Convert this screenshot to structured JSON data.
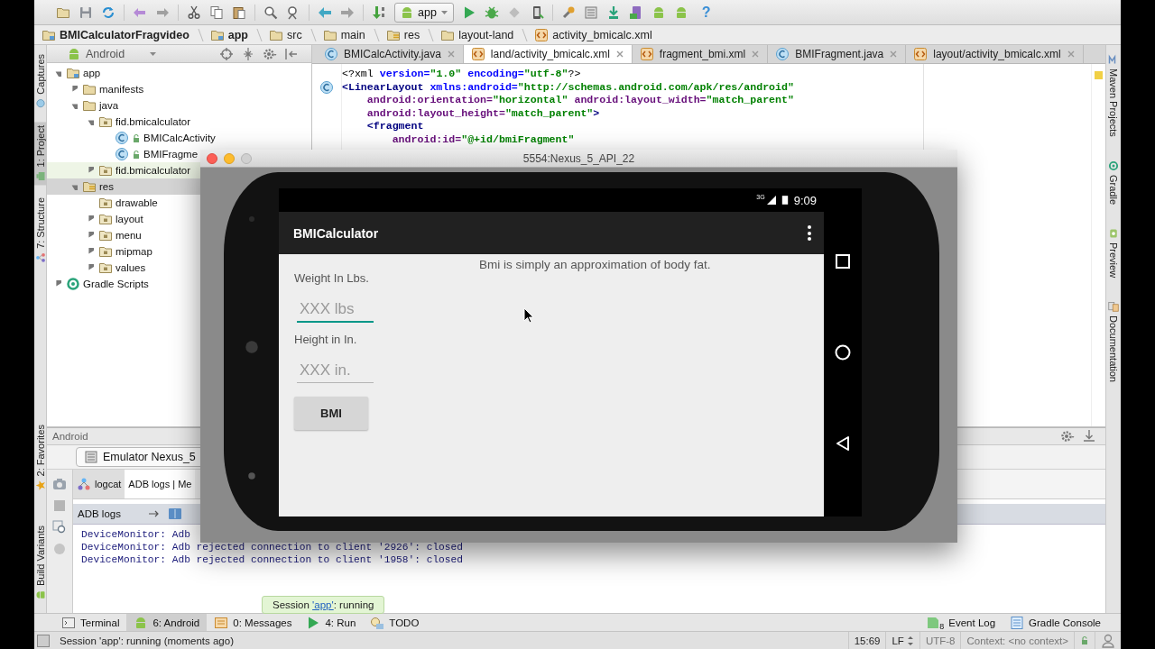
{
  "toolbar": {
    "run_config": "app",
    "help": "?"
  },
  "breadcrumbs": [
    {
      "label": "BMICalculatorFragvideo",
      "kind": "module"
    },
    {
      "label": "app",
      "kind": "module"
    },
    {
      "label": "src",
      "kind": "folder"
    },
    {
      "label": "main",
      "kind": "folder"
    },
    {
      "label": "res",
      "kind": "res"
    },
    {
      "label": "layout-land",
      "kind": "folder"
    },
    {
      "label": "activity_bmicalc.xml",
      "kind": "xml"
    }
  ],
  "left_stripe": {
    "top": [
      {
        "label": "Captures",
        "kind": "captures",
        "selected": false
      },
      {
        "label": "1: Project",
        "kind": "project",
        "selected": true
      },
      {
        "label": "7: Structure",
        "kind": "structure",
        "selected": false
      }
    ],
    "bottom": [
      {
        "label": "2: Favorites",
        "kind": "favorites",
        "selected": false
      },
      {
        "label": "Build Variants",
        "kind": "variants",
        "selected": false
      }
    ]
  },
  "project_panel": {
    "view": "Android",
    "tree": [
      {
        "label": "app",
        "kind": "module",
        "expanded": true,
        "selected": false,
        "children": [
          {
            "label": "manifests",
            "kind": "folder",
            "expanded": false,
            "selected": false
          },
          {
            "label": "java",
            "kind": "folder",
            "expanded": true,
            "selected": false,
            "children": [
              {
                "label": "fid.bmicalculator",
                "kind": "package",
                "expanded": true,
                "selected": false,
                "children": [
                  {
                    "label": "BMICalcActivity",
                    "kind": "class",
                    "selected": false
                  },
                  {
                    "label": "BMIFragme",
                    "kind": "class",
                    "selected": false
                  }
                ]
              },
              {
                "label": "fid.bmicalculator",
                "kind": "package",
                "expanded": false,
                "selected": false,
                "highlighted": true
              }
            ]
          },
          {
            "label": "res",
            "kind": "res",
            "expanded": true,
            "selected": true,
            "children": [
              {
                "label": "drawable",
                "kind": "package",
                "selected": false
              },
              {
                "label": "layout",
                "kind": "package",
                "expanded": false,
                "selected": false
              },
              {
                "label": "menu",
                "kind": "package",
                "expanded": false,
                "selected": false
              },
              {
                "label": "mipmap",
                "kind": "package",
                "expanded": false,
                "selected": false
              },
              {
                "label": "values",
                "kind": "package",
                "expanded": false,
                "selected": false
              }
            ]
          }
        ]
      },
      {
        "label": "Gradle Scripts",
        "kind": "gradle",
        "expanded": false,
        "selected": false
      }
    ]
  },
  "editor": {
    "tabs": [
      {
        "label": "BMICalcActivity.java",
        "kind": "java",
        "selected": false
      },
      {
        "label": "land/activity_bmicalc.xml",
        "kind": "xml",
        "selected": true
      },
      {
        "label": "fragment_bmi.xml",
        "kind": "xml",
        "selected": false
      },
      {
        "label": "BMIFragment.java",
        "kind": "java",
        "selected": false
      },
      {
        "label": "layout/activity_bmicalc.xml",
        "kind": "xml",
        "selected": false
      }
    ],
    "lines": [
      [
        {
          "text": "<?xml ",
          "kind": "plain"
        },
        {
          "text": "version=",
          "kind": "attr"
        },
        {
          "text": "\"1.0\" ",
          "kind": "value"
        },
        {
          "text": "encoding=",
          "kind": "attr"
        },
        {
          "text": "\"utf-8\"",
          "kind": "value"
        },
        {
          "text": "?>",
          "kind": "plain"
        }
      ],
      [
        {
          "text": "<LinearLayout ",
          "kind": "tag"
        },
        {
          "text": "xmlns:android=",
          "kind": "attr"
        },
        {
          "text": "\"http://schemas.android.com/apk/res/android\"",
          "kind": "value"
        }
      ],
      [
        {
          "text": "    android:orientation=",
          "kind": "ns"
        },
        {
          "text": "\"horizontal\" ",
          "kind": "value"
        },
        {
          "text": "android:layout_width=",
          "kind": "ns"
        },
        {
          "text": "\"match_parent\"",
          "kind": "value"
        }
      ],
      [
        {
          "text": "    android:layout_height=",
          "kind": "ns"
        },
        {
          "text": "\"match_parent\"",
          "kind": "value"
        },
        {
          "text": ">",
          "kind": "tag"
        }
      ],
      [
        {
          "text": "    <fragment",
          "kind": "tag"
        }
      ],
      [
        {
          "text": "        android:id=",
          "kind": "ns"
        },
        {
          "text": "\"@+id/bmiFragment\"",
          "kind": "value"
        }
      ]
    ]
  },
  "right_stripe": [
    {
      "label": "Maven Projects",
      "kind": "maven"
    },
    {
      "label": "Gradle",
      "kind": "gradle"
    },
    {
      "label": "Preview",
      "kind": "preview"
    },
    {
      "label": "Documentation",
      "kind": "docs"
    }
  ],
  "android_panel": {
    "title": "Android",
    "device": "Emulator Nexus_5",
    "tabs": [
      {
        "label": "logcat",
        "selected": false
      },
      {
        "label": "ADB logs | Me",
        "selected": true
      }
    ],
    "subheader": "ADB logs",
    "log": [
      "DeviceMonitor: Adb",
      "DeviceMonitor: Adb rejected connection to client '2926': closed",
      "DeviceMonitor: Adb rejected connection to client '1958': closed"
    ]
  },
  "emulator": {
    "title": "5554:Nexus_5_API_22",
    "network": "3G",
    "time": "9:09",
    "app_title": "BMICalculator",
    "description": "Bmi is simply an approximation of body fat.",
    "fields": [
      {
        "label": "Weight In Lbs.",
        "placeholder": "XXX lbs",
        "focused": true
      },
      {
        "label": "Height in In.",
        "placeholder": "XXX in.",
        "focused": false
      }
    ],
    "button": "BMI"
  },
  "tooltip": {
    "before": "Session ",
    "link": "'app'",
    "after": ": running"
  },
  "tool_buttons": {
    "left": [
      {
        "label": "Terminal",
        "kind": "terminal",
        "selected": false
      },
      {
        "label": "6: Android",
        "kind": "android",
        "selected": true
      },
      {
        "label": "0: Messages",
        "kind": "messages",
        "selected": false
      },
      {
        "label": "4: Run",
        "kind": "run",
        "selected": false
      },
      {
        "label": "TODO",
        "kind": "todo",
        "selected": false
      }
    ],
    "right": [
      {
        "label": "Event Log",
        "kind": "event",
        "count": "8"
      },
      {
        "label": "Gradle Console",
        "kind": "console"
      }
    ]
  },
  "status_bar": {
    "message": "Session 'app': running (moments ago)",
    "position": "15:69",
    "line_separator": "LF",
    "encoding": "UTF-8",
    "context": "Context: <no context>"
  }
}
